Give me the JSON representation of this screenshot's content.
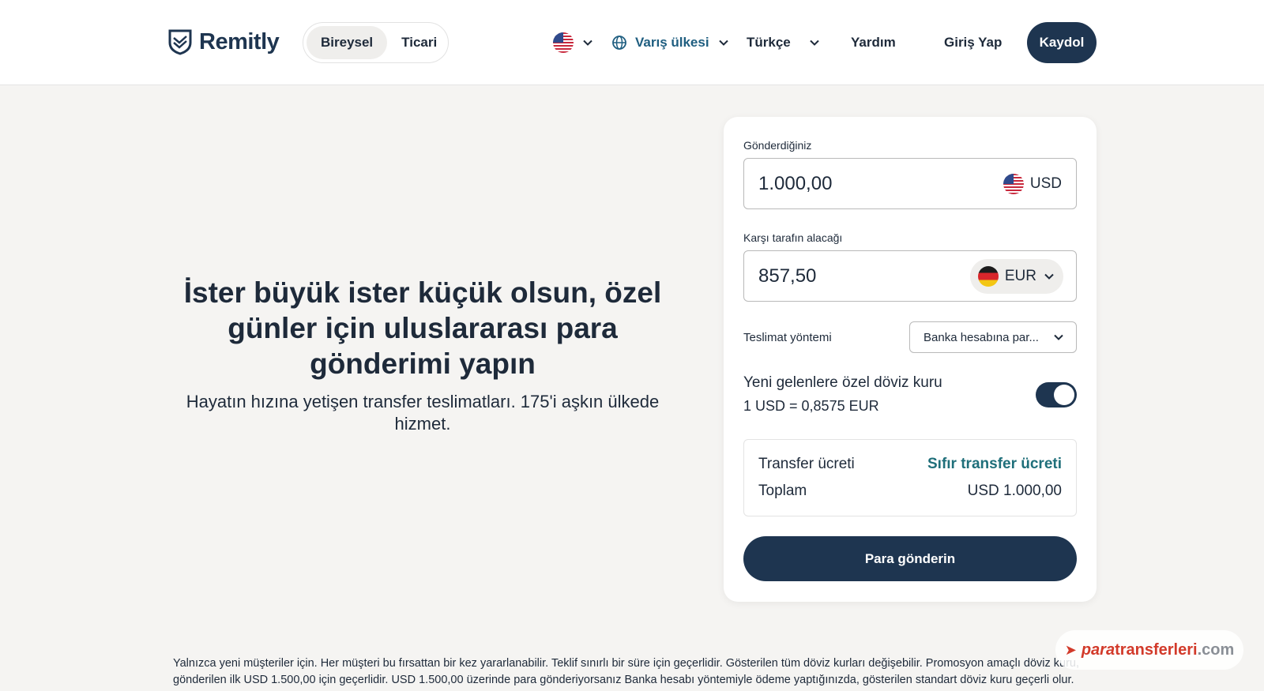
{
  "header": {
    "logo_text": "Remitly",
    "segments": [
      {
        "label": "Bireysel",
        "active": true
      },
      {
        "label": "Ticari",
        "active": false
      }
    ],
    "destination_label": "Varış ülkesi",
    "language_label": "Türkçe",
    "help_label": "Yardım",
    "login_label": "Giriş Yap",
    "signup_label": "Kaydol",
    "accent_color": "#1f5e80",
    "brand_color": "#1e3550"
  },
  "hero": {
    "title": "İster büyük ister küçük olsun, özel günler için uluslararası para gönderimi yapın",
    "subtitle": "Hayatın hızına yetişen transfer teslimatları. 175'i aşkın ülkede hizmet."
  },
  "calculator": {
    "send_label": "Gönderdiğiniz",
    "send_amount": "1.000,00",
    "send_currency": "USD",
    "receive_label": "Karşı tarafın alacağı",
    "receive_amount": "857,50",
    "receive_currency": "EUR",
    "delivery_label": "Teslimat yöntemi",
    "delivery_value": "Banka hesabına par...",
    "rate_title": "Yeni gelenlere özel döviz kuru",
    "rate_value": "1 USD = 0,8575 EUR",
    "rate_toggle_on": true,
    "fee_label": "Transfer ücreti",
    "fee_value": "Sıfır transfer ücreti",
    "total_label": "Toplam",
    "total_value": "USD 1.000,00",
    "send_button": "Para gönderin"
  },
  "footer": {
    "disclaimer": "Yalnızca yeni müşteriler için. Her müşteri bu fırsattan bir kez yararlanabilir. Teklif sınırlı bir süre için geçerlidir. Gösterilen tüm döviz kurları değişebilir. Promosyon amaçlı döviz kuru, gönderilen ilk USD 1.500,00 için geçerlidir. USD 1.500,00 üzerinde para gönderiyorsanız Banka hesabı yöntemiyle ödeme yaptığınızda, gösterilen standart döviz kuru geçerli olur."
  },
  "watermark": {
    "part1": "para",
    "part2": "transferleri",
    "part3": ".com"
  },
  "icons": [
    "remitly-logo-icon",
    "us-flag-icon",
    "chevron-down-icon",
    "globe-icon",
    "de-flag-icon"
  ]
}
